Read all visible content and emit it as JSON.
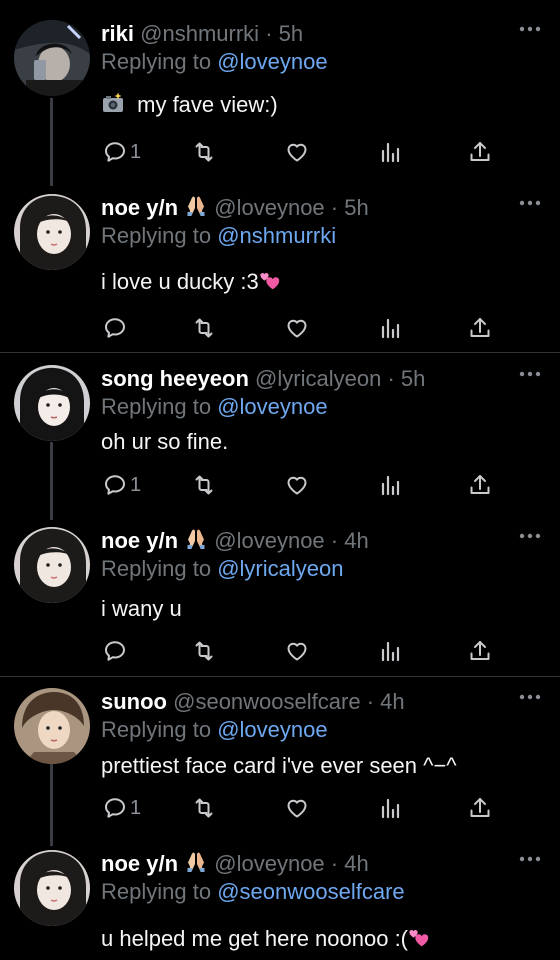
{
  "tweets": [
    {
      "name": "riki",
      "handle": "@nshmurrki",
      "separator": "·",
      "time": "5h",
      "reply_prefix": "Replying to",
      "reply_to": "@loveynoe",
      "text": "my fave view:)",
      "text_emoji_before": "camera-flash-emoji",
      "reply_count": "1",
      "avatar_icon": "avatar-riki"
    },
    {
      "name": "noe y/n",
      "handle": "@loveynoe",
      "separator": "·",
      "time": "5h",
      "reply_prefix": "Replying to",
      "reply_to": "@nshmurrki",
      "text": "i love u ducky :3",
      "text_emoji_after": "two-hearts-emoji",
      "reply_count": "",
      "avatar_icon": "avatar-noe"
    },
    {
      "name": "song heeyeon",
      "handle": "@lyricalyeon",
      "separator": "·",
      "time": "5h",
      "reply_prefix": "Replying to",
      "reply_to": "@loveynoe",
      "text": "oh ur so fine.",
      "reply_count": "1",
      "avatar_icon": "avatar-heeyeon"
    },
    {
      "name": "noe y/n",
      "handle": "@loveynoe",
      "separator": "·",
      "time": "4h",
      "reply_prefix": "Replying to",
      "reply_to": "@lyricalyeon",
      "text": "i wany u",
      "reply_count": "",
      "avatar_icon": "avatar-noe"
    },
    {
      "name": "sunoo",
      "handle": "@seonwooselfcare",
      "separator": "·",
      "time": "4h",
      "reply_prefix": "Replying to",
      "reply_to": "@loveynoe",
      "text": "prettiest face card i've ever seen ^−^",
      "reply_count": "1",
      "avatar_icon": "avatar-sunoo"
    },
    {
      "name": "noe y/n",
      "handle": "@loveynoe",
      "separator": "·",
      "time": "4h",
      "reply_prefix": "Replying to",
      "reply_to": "@seonwooselfcare",
      "text": "u helped me get here noonoo :(",
      "text_emoji_after": "two-hearts-emoji",
      "reply_count": "",
      "avatar_icon": "avatar-noe"
    }
  ],
  "name_emoji": "praying-hands-emoji",
  "colors": {
    "background": "#000000",
    "mention": "#6ea8f0",
    "muted": "#71767b",
    "divider": "#2f3336"
  }
}
